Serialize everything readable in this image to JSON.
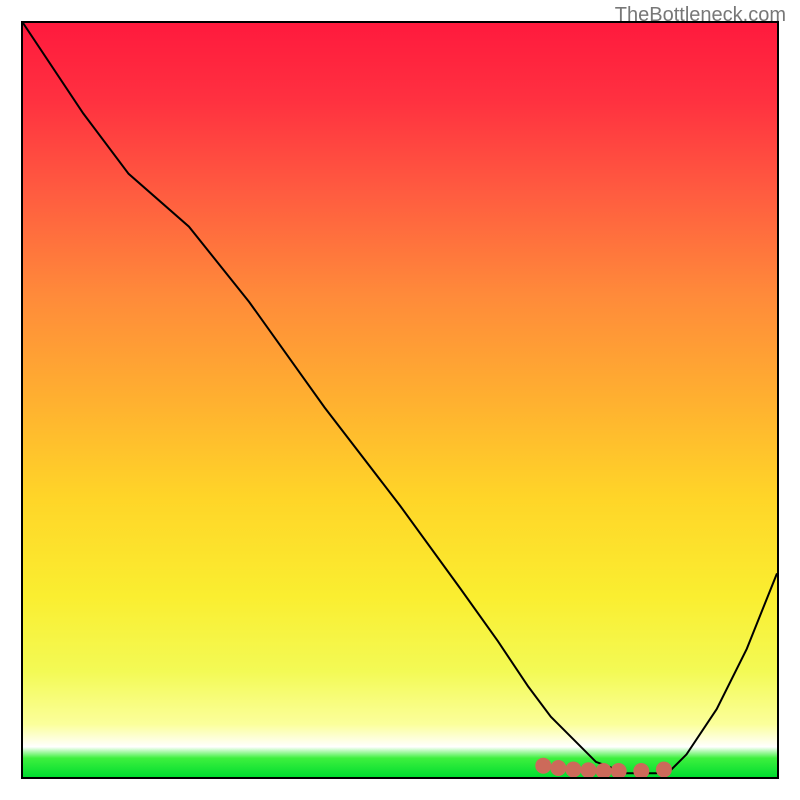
{
  "watermark": "TheBottleneck.com",
  "chart_data": {
    "type": "line",
    "title": "",
    "xlabel": "",
    "ylabel": "",
    "xlim": [
      0,
      100
    ],
    "ylim": [
      0,
      100
    ],
    "series": [
      {
        "name": "bottleneck-curve",
        "x": [
          0,
          8,
          14,
          22,
          30,
          40,
          50,
          58,
          63,
          67,
          70,
          73,
          76,
          80,
          84,
          86,
          88,
          92,
          96,
          100
        ],
        "values": [
          100,
          88,
          80,
          73,
          63,
          49,
          36,
          25,
          18,
          12,
          8,
          5,
          2,
          0.5,
          0.5,
          1,
          3,
          9,
          17,
          27
        ]
      }
    ],
    "annotations": [
      {
        "name": "optimal-dots",
        "type": "marker",
        "color": "#cc6a5a",
        "points": [
          {
            "x": 69,
            "y": 1.5
          },
          {
            "x": 71,
            "y": 1.2
          },
          {
            "x": 73,
            "y": 1.0
          },
          {
            "x": 75,
            "y": 0.9
          },
          {
            "x": 77,
            "y": 0.8
          },
          {
            "x": 79,
            "y": 0.8
          },
          {
            "x": 82,
            "y": 0.8
          },
          {
            "x": 85,
            "y": 1.0
          }
        ]
      }
    ],
    "colors": {
      "curve": "#000000",
      "marker": "#cc6a5a",
      "frame": "#000000"
    }
  }
}
